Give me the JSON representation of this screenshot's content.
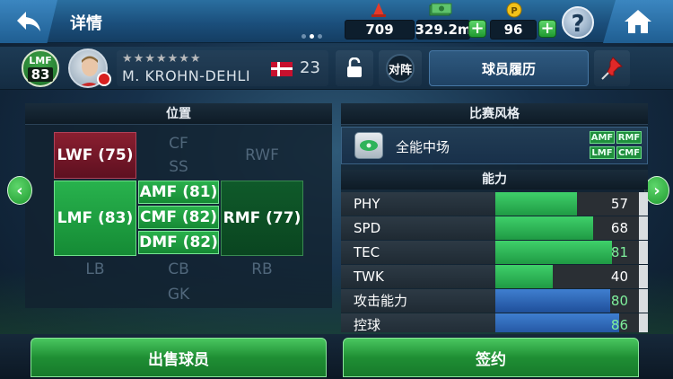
{
  "header": {
    "title": "详情",
    "resources": {
      "tokens": "709",
      "money": "329.2m",
      "coins": "96"
    },
    "page_indicator": {
      "pages": 3,
      "active": 2
    }
  },
  "player": {
    "position": "LMF",
    "overall": "83",
    "stars": "★★★★★★★",
    "name": "M. KROHN-DEHLI",
    "age": "23",
    "compare_label": "对阵",
    "history_label": "球员履历"
  },
  "positions": {
    "header": "位置",
    "cells": {
      "cf": "CF",
      "ss": "SS",
      "lwf": "LWF (75)",
      "rwf": "RWF",
      "lmf": "LMF (83)",
      "amf": "AMF (81)",
      "cmf": "CMF (82)",
      "dmf": "DMF (82)",
      "rmf": "RMF (77)",
      "lb": "LB",
      "cb": "CB",
      "rb": "RB",
      "gk": "GK"
    }
  },
  "play_style": {
    "header": "比赛风格",
    "name": "全能中场",
    "tags": [
      "AMF",
      "RMF",
      "LMF",
      "CMF"
    ]
  },
  "abilities": {
    "header": "能力",
    "stats": [
      {
        "label": "PHY",
        "value": 57,
        "max": 100,
        "bar_color": "green"
      },
      {
        "label": "SPD",
        "value": 68,
        "max": 100,
        "bar_color": "green"
      },
      {
        "label": "TEC",
        "value": 81,
        "max": 100,
        "bar_color": "green",
        "highlight": true
      },
      {
        "label": "TWK",
        "value": 40,
        "max": 100,
        "bar_color": "green"
      },
      {
        "label": "攻击能力",
        "value": 80,
        "max": 100,
        "bar_color": "blue",
        "highlight": true
      },
      {
        "label": "控球",
        "value": 86,
        "max": 100,
        "bar_color": "blue",
        "highlight": true
      }
    ]
  },
  "actions": {
    "sell": "出售球员",
    "sign": "签约"
  }
}
